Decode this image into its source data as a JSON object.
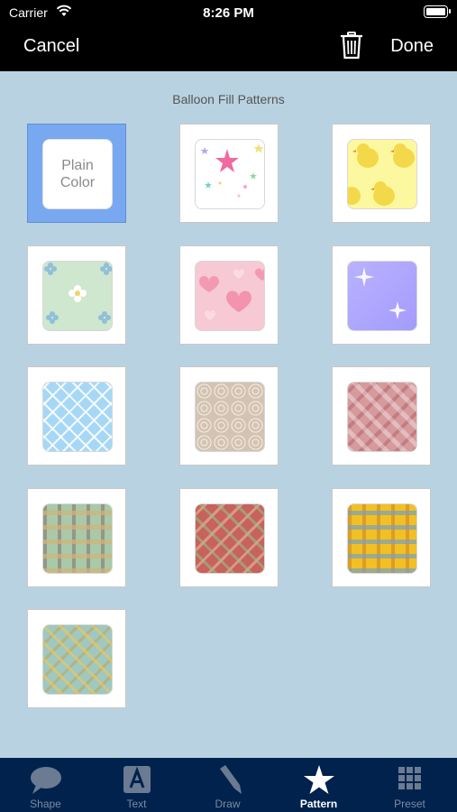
{
  "status_bar": {
    "carrier": "Carrier",
    "time": "8:26 PM"
  },
  "nav": {
    "cancel_label": "Cancel",
    "done_label": "Done"
  },
  "section_title": "Balloon Fill Patterns",
  "patterns": [
    {
      "name": "Plain\nColor",
      "selected": true
    },
    {
      "name": "stars"
    },
    {
      "name": "chicks"
    },
    {
      "name": "floral"
    },
    {
      "name": "hearts"
    },
    {
      "name": "sparkle"
    },
    {
      "name": "lattice"
    },
    {
      "name": "circles"
    },
    {
      "name": "pink-plaid"
    },
    {
      "name": "green-plaid"
    },
    {
      "name": "red-plaid"
    },
    {
      "name": "yellow-plaid"
    },
    {
      "name": "teal-plaid"
    }
  ],
  "tabs": [
    {
      "label": "Shape",
      "icon": "speech-bubble-icon"
    },
    {
      "label": "Text",
      "icon": "text-a-icon"
    },
    {
      "label": "Draw",
      "icon": "pencil-icon"
    },
    {
      "label": "Pattern",
      "icon": "star-icon",
      "active": true
    },
    {
      "label": "Preset",
      "icon": "grid-icon"
    }
  ],
  "colors": {
    "background": "#b9d2e1",
    "tabbar": "#00224d",
    "selected": "#78a8f0"
  }
}
